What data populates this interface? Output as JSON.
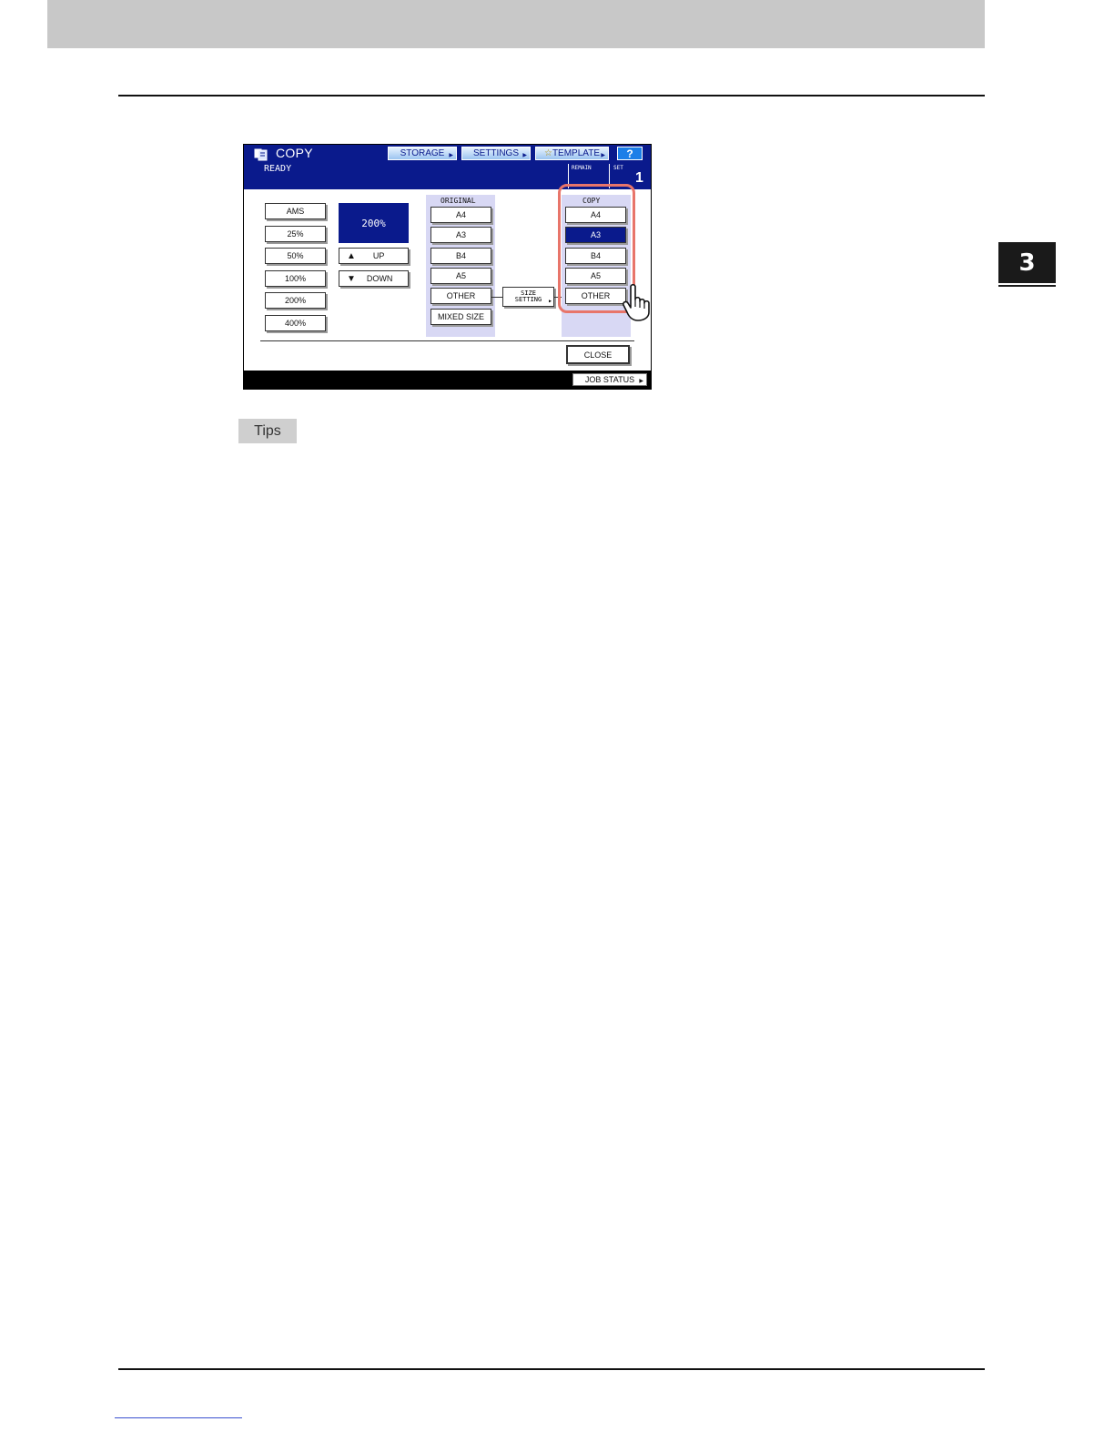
{
  "chapter": "3",
  "tips_label": "Tips",
  "panel": {
    "mode_title": "COPY",
    "toolbar": {
      "storage": "STORAGE",
      "settings": "SETTINGS",
      "template": "TEMPLATE",
      "help": "?"
    },
    "status": "READY",
    "remain_label": "REMAIN",
    "set_label": "SET",
    "set_value": "1",
    "zoom_presets": [
      "AMS",
      "25%",
      "50%",
      "100%",
      "200%",
      "400%"
    ],
    "zoom_display": "200%",
    "up_label": "UP",
    "down_label": "DOWN",
    "original_label": "ORIGINAL",
    "original_sizes": [
      "A4",
      "A3",
      "B4",
      "A5",
      "OTHER"
    ],
    "mixed_size": "MIXED SIZE",
    "size_setting_line1": "SIZE",
    "size_setting_line2": "SETTING",
    "copy_label": "COPY",
    "copy_sizes": [
      "A4",
      "A3",
      "B4",
      "A5",
      "OTHER"
    ],
    "copy_selected": "A3",
    "close_label": "CLOSE",
    "job_status": "JOB STATUS"
  },
  "colors": {
    "accent": "#0a1a8c",
    "highlight": "#e8756a",
    "panel_bg": "#d8d8f4"
  }
}
